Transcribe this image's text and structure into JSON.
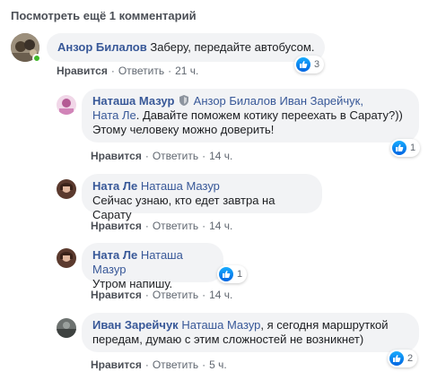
{
  "view_more": "Посмотреть ещё 1 комментарий",
  "actions": {
    "like": "Нравится",
    "reply": "Ответить",
    "sep": "·"
  },
  "comments": [
    {
      "author": "Анзор Билалов",
      "text": "Заберу, передайте автобусом.",
      "time": "21 ч.",
      "reactions": "3"
    },
    {
      "author": "Наташа Мазур",
      "mentions_line1": "Анзор Билалов Иван Зарейчук,",
      "mention_nata": "Ната Ле",
      "text_line1": ". Давайте поможем котику переехать в Сарату?))",
      "text_line2": "Этому человеку можно доверить!",
      "time": "14 ч.",
      "reactions": "1"
    },
    {
      "author": "Ната Ле",
      "mention": "Наташа Мазур",
      "text": "Сейчас узнаю, кто едет завтра на Сарату",
      "time": "14 ч."
    },
    {
      "author": "Ната Ле",
      "mention": "Наташа Мазур",
      "text": "Утром напишу.",
      "time": "14 ч.",
      "reactions": "1"
    },
    {
      "author": "Иван Зарейчук",
      "mention": "Наташа Мазур",
      "text_line1": ", я сегодня маршруткой",
      "text_line2": "передам, думаю с этим сложностей не возникнет)",
      "time": "5 ч.",
      "reactions": "2"
    }
  ],
  "colors": {
    "link": "#385898",
    "bubble": "#f2f3f5",
    "like": "#1877f2",
    "online": "#42b72a"
  },
  "icons": [
    "like-icon",
    "shield-icon"
  ]
}
